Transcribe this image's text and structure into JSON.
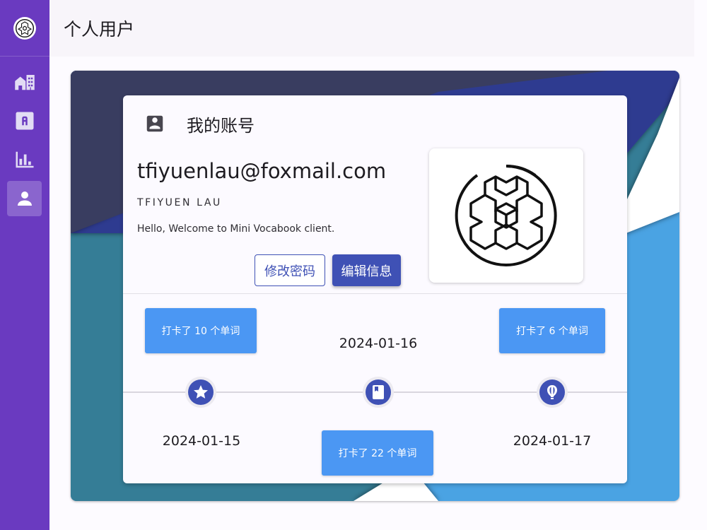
{
  "header": {
    "title": "个人用户"
  },
  "sidebar": {
    "items": [
      {
        "name": "home",
        "icon": "buildings-icon",
        "active": false
      },
      {
        "name": "vocab",
        "icon": "letter-a-icon",
        "active": false
      },
      {
        "name": "stats",
        "icon": "bar-chart-icon",
        "active": false
      },
      {
        "name": "user",
        "icon": "person-icon",
        "active": true
      }
    ]
  },
  "account": {
    "section_title": "我的账号",
    "email": "tfiyuenlau@foxmail.com",
    "username": "TFIYUEN LAU",
    "welcome": "Hello, Welcome to Mini Vocabook client.",
    "change_password_label": "修改密码",
    "edit_info_label": "编辑信息"
  },
  "timeline": {
    "events": [
      {
        "date": "2024-01-15",
        "checkin": "打卡了 10 个单词",
        "icon": "star-icon"
      },
      {
        "date": "2024-01-16",
        "checkin": "打卡了 22 个单词",
        "icon": "book-icon"
      },
      {
        "date": "2024-01-17",
        "checkin": "打卡了 6 个单词",
        "icon": "balloon-icon"
      }
    ]
  },
  "colors": {
    "sidebar": "#6a3ac0",
    "primary": "#3f51b5",
    "checkin": "#4b97f3"
  }
}
